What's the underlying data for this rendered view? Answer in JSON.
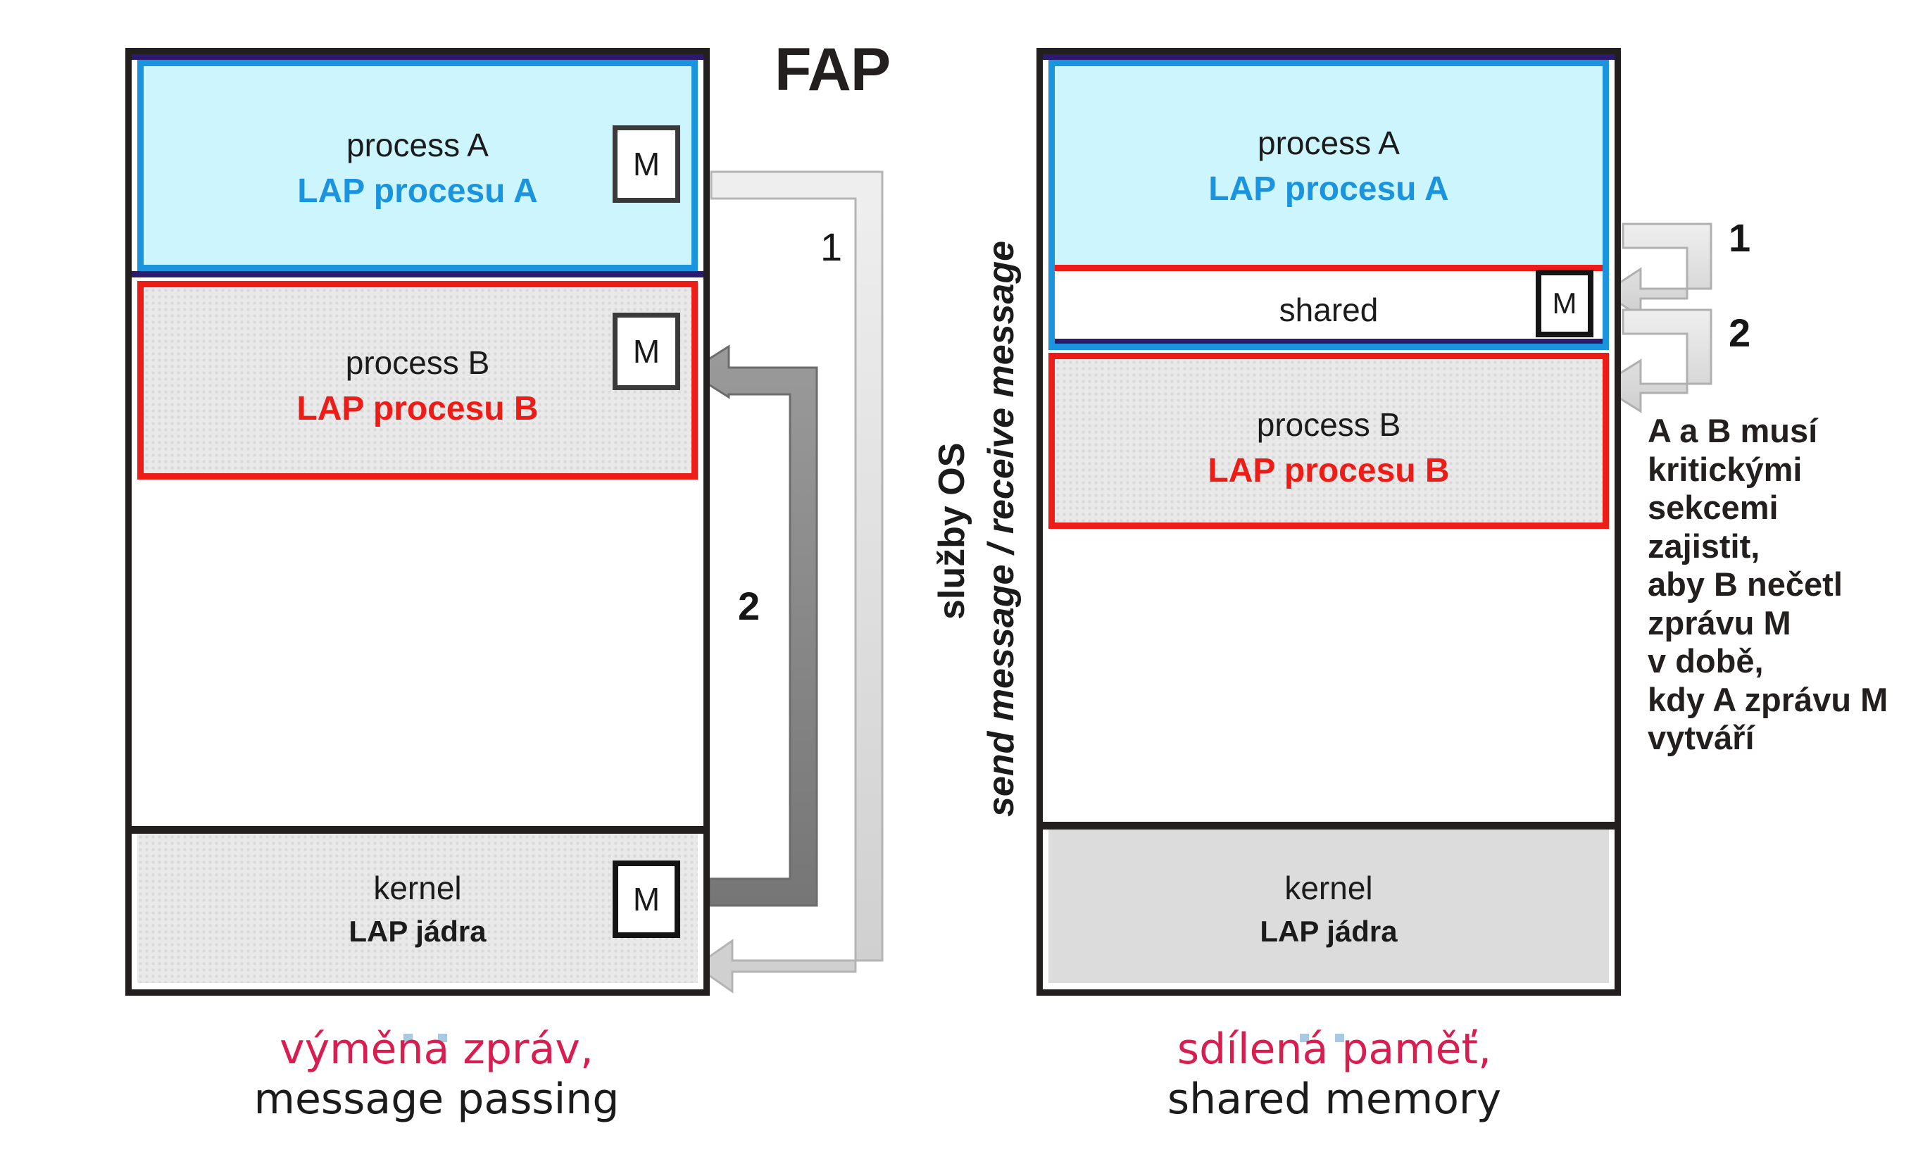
{
  "title": "FAP",
  "colors": {
    "frame": "#231f1e",
    "process_a_fill": "#cdf5fd",
    "process_a_border": "#1b94e0",
    "process_b_border": "#ee1c16",
    "navy_rule": "#2b1a6e",
    "kernel_fill": "#dcdcdc",
    "stipple_fill": "#e9e9e9",
    "caption_accent": "#d81e50",
    "arrow_light": "#d4d4d4",
    "arrow_dark": "#7c7c7c"
  },
  "left_diagram": {
    "name": "message-passing",
    "process_a": {
      "label": "process A",
      "sublabel": "LAP procesu A",
      "message_box": "M"
    },
    "process_b": {
      "label": "process B",
      "sublabel": "LAP procesu B",
      "message_box": "M"
    },
    "kernel": {
      "label": "kernel",
      "sublabel": "LAP jádra",
      "message_box": "M"
    },
    "arrow_labels": {
      "first": "1",
      "second": "2"
    }
  },
  "right_diagram": {
    "name": "shared-memory",
    "process_a": {
      "label": "process A",
      "sublabel": "LAP procesu A"
    },
    "shared": {
      "label": "shared",
      "message_box": "M"
    },
    "process_b": {
      "label": "process B",
      "sublabel": "LAP procesu B"
    },
    "kernel": {
      "label": "kernel",
      "sublabel": "LAP jádra"
    },
    "arrow_labels": {
      "first": "1",
      "second": "2"
    }
  },
  "center_legend": {
    "line1": "služby OS",
    "line2": "send message / receive message"
  },
  "side_note": "A a B musí\nkritickými\nsekcemi\nzajistit,\naby B nečetl\nzprávu M\nv době,\nkdy A zprávu M\nvytváří",
  "captions": {
    "left": {
      "cs": "výměna zpráv,",
      "en": "message passing"
    },
    "right": {
      "cs": "sdílená paměť,",
      "en": "shared memory"
    }
  }
}
